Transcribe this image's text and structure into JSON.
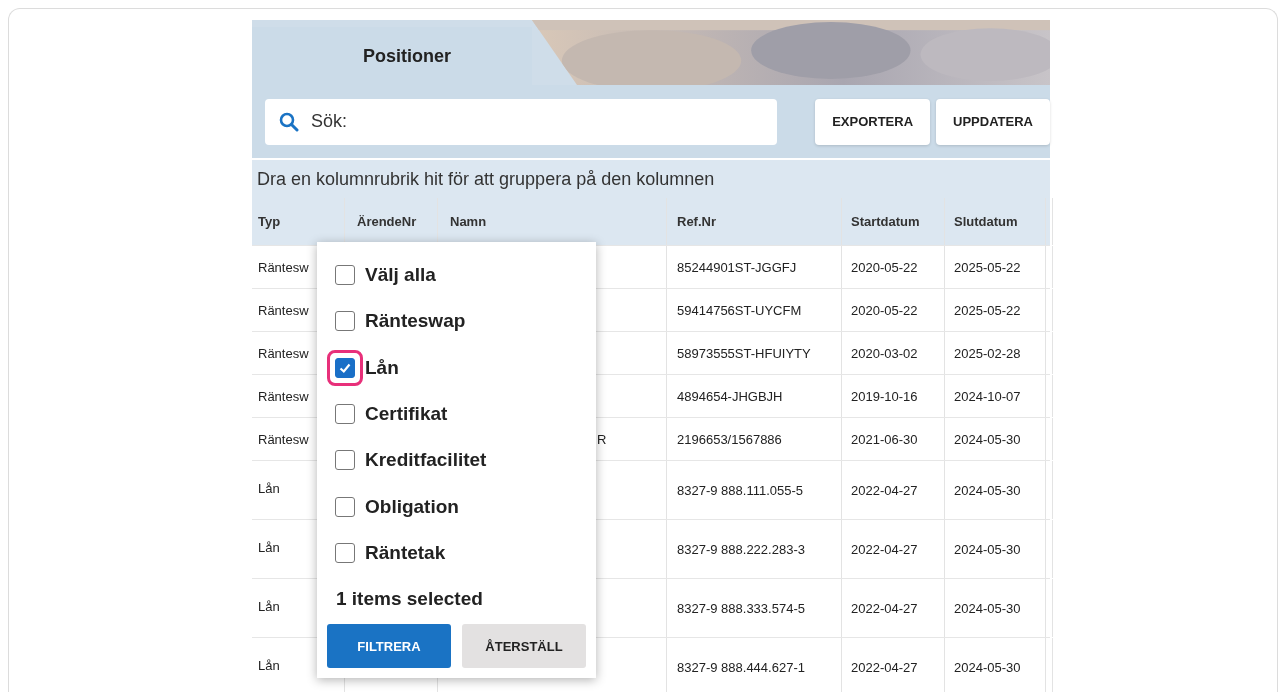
{
  "tab": {
    "label": "Positioner",
    "selected": true
  },
  "search": {
    "placeholder": "Sök:"
  },
  "buttons": [
    "EXPORTERA",
    "UPPDATERA"
  ],
  "group_panel": "Dra en kolumnrubrik hit för att gruppera på den kolumnen",
  "table": {
    "columns": [
      "Typ",
      "ÄrendeNr",
      "Namn",
      "Ref.Nr",
      "Startdatum",
      "Slutdatum"
    ],
    "rows": [
      {
        "typ": "Räntesw",
        "namn": "",
        "ref": "85244901ST-JGGFJ",
        "start": "2020-05-22",
        "slut": "2025-05-22",
        "tall": false
      },
      {
        "typ": "Räntesw",
        "namn": "",
        "ref": "59414756ST-UYCFM",
        "start": "2020-05-22",
        "slut": "2025-05-22",
        "tall": false
      },
      {
        "typ": "Räntesw",
        "namn": "",
        "ref": "58973555ST-HFUIYTY",
        "start": "2020-03-02",
        "slut": "2025-02-28",
        "tall": false
      },
      {
        "typ": "Räntesw",
        "namn": "",
        "ref": "4894654-JHGBJH",
        "start": "2019-10-16",
        "slut": "2024-10-07",
        "tall": false
      },
      {
        "typ": "Räntesw",
        "namn": "R",
        "ref": "2196653/1567886",
        "start": "2021-06-30",
        "slut": "2024-05-30",
        "tall": false
      },
      {
        "typ": "Lån",
        "namn": "",
        "ref": "8327-9 888.111.055-5",
        "start": "2022-04-27",
        "slut": "2024-05-30",
        "tall": true
      },
      {
        "typ": "Lån",
        "namn": "",
        "ref": "8327-9 888.222.283-3",
        "start": "2022-04-27",
        "slut": "2024-05-30",
        "tall": true
      },
      {
        "typ": "Lån",
        "namn": "",
        "ref": "8327-9 888.333.574-5",
        "start": "2022-04-27",
        "slut": "2024-05-30",
        "tall": true
      },
      {
        "typ": "Lån",
        "namn": "",
        "ref": "8327-9 888.444.627-1",
        "start": "2022-04-27",
        "slut": "2024-05-30",
        "tall": true
      }
    ]
  },
  "filter_popup": {
    "options": [
      {
        "label": "Välj alla",
        "checked": false,
        "highlighted": false
      },
      {
        "label": "Ränteswap",
        "checked": false,
        "highlighted": false
      },
      {
        "label": "Lån",
        "checked": true,
        "highlighted": true
      },
      {
        "label": "Certifikat",
        "checked": false,
        "highlighted": false
      },
      {
        "label": "Kreditfacilitet",
        "checked": false,
        "highlighted": false
      },
      {
        "label": "Obligation",
        "checked": false,
        "highlighted": false
      },
      {
        "label": "Räntetak",
        "checked": false,
        "highlighted": false
      }
    ],
    "summary": "1 items selected",
    "buttons": [
      {
        "label": "FILTRERA",
        "kind": "primary"
      },
      {
        "label": "ÅTERSTÄLL",
        "kind": "secondary"
      }
    ]
  }
}
